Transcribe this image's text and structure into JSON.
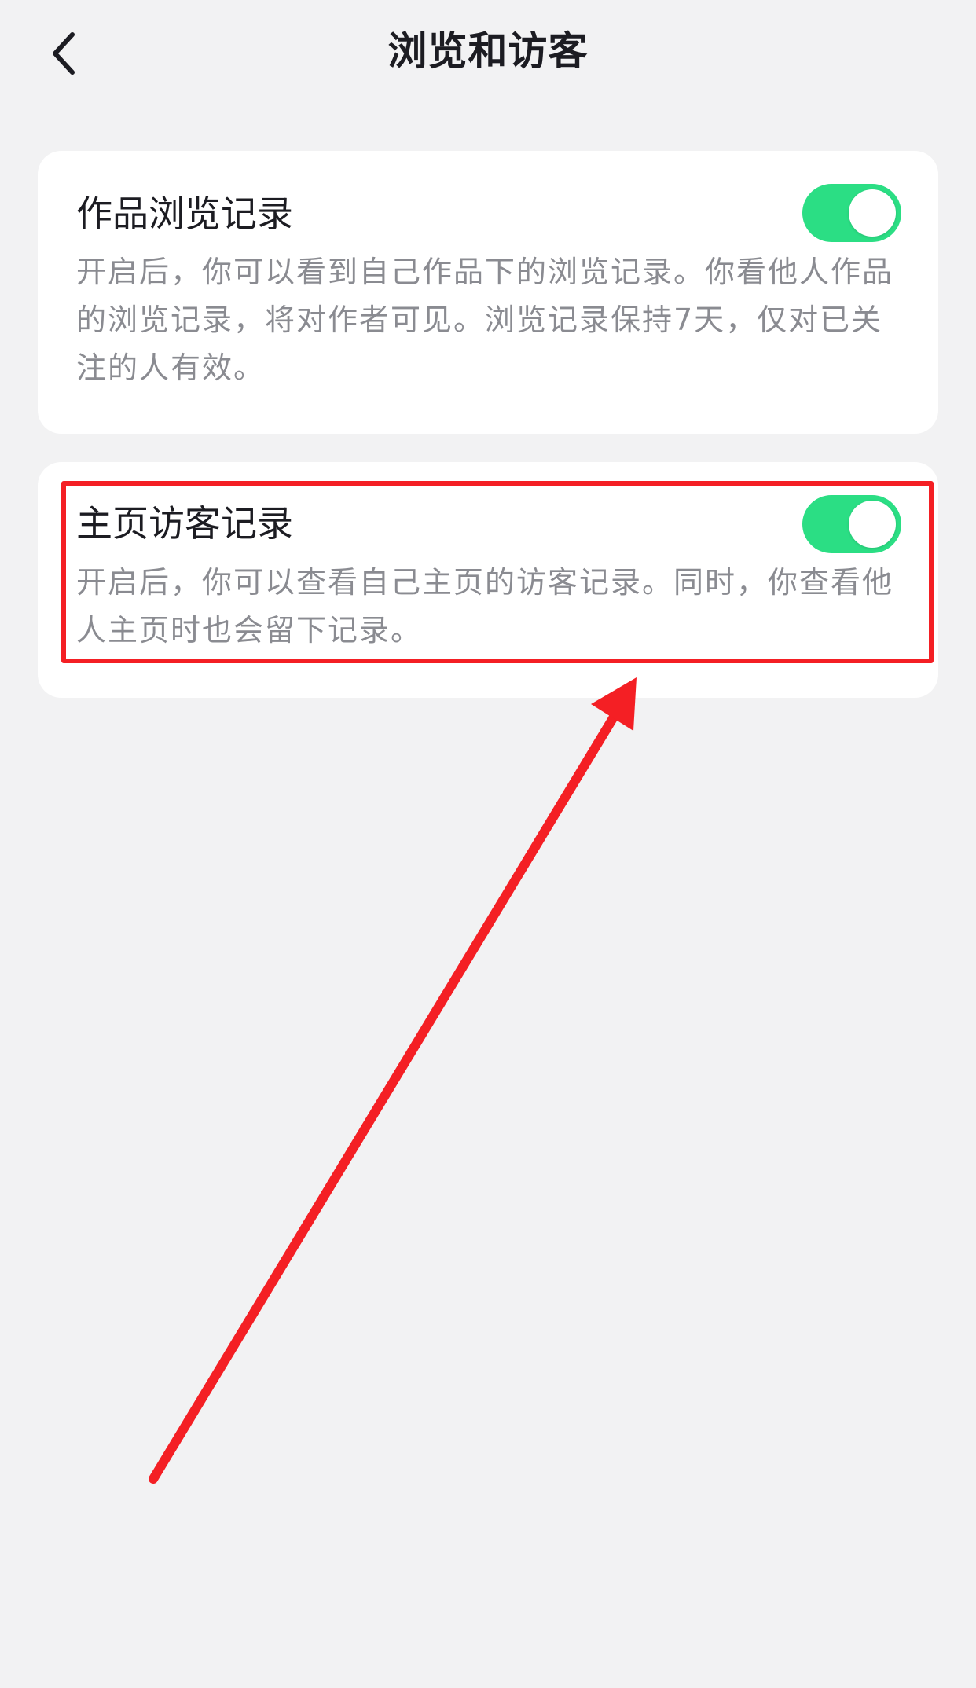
{
  "header": {
    "title": "浏览和访客",
    "back_icon": "chevron-left-icon"
  },
  "settings": [
    {
      "title": "作品浏览记录",
      "description": "开启后，你可以看到自己作品下的浏览记录。你看他人作品的浏览记录，将对作者可见。浏览记录保持7天，仅对已关注的人有效。",
      "enabled": true
    },
    {
      "title": "主页访客记录",
      "description": "开启后，你可以查看自己主页的访客记录。同时，你查看他人主页时也会留下记录。",
      "enabled": true
    }
  ],
  "colors": {
    "background": "#f2f2f3",
    "card": "#ffffff",
    "toggle_on": "#2bde84",
    "annotation": "#f41f24",
    "title_text": "#1c1c22",
    "desc_text": "#8a8b91"
  }
}
